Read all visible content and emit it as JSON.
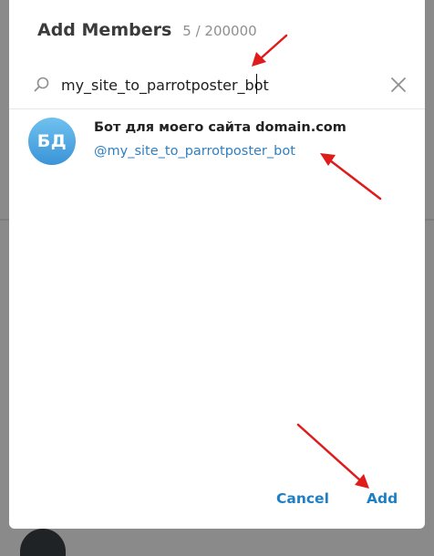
{
  "dialog": {
    "title": "Add Members",
    "count": "5 / 200000"
  },
  "search": {
    "value": "my_site_to_parrotposter_bot",
    "search_icon": "search-icon",
    "clear_icon": "close-icon"
  },
  "results": [
    {
      "initials": "БД",
      "name": "Бот для моего сайта domain.com",
      "username": "@my_site_to_parrotposter_bot"
    }
  ],
  "buttons": {
    "cancel": "Cancel",
    "add": "Add"
  },
  "colors": {
    "accent": "#1f7fc4",
    "annotation_arrow": "#e01b1b",
    "avatar_top": "#6fc1ef",
    "avatar_bottom": "#3a94d7"
  }
}
